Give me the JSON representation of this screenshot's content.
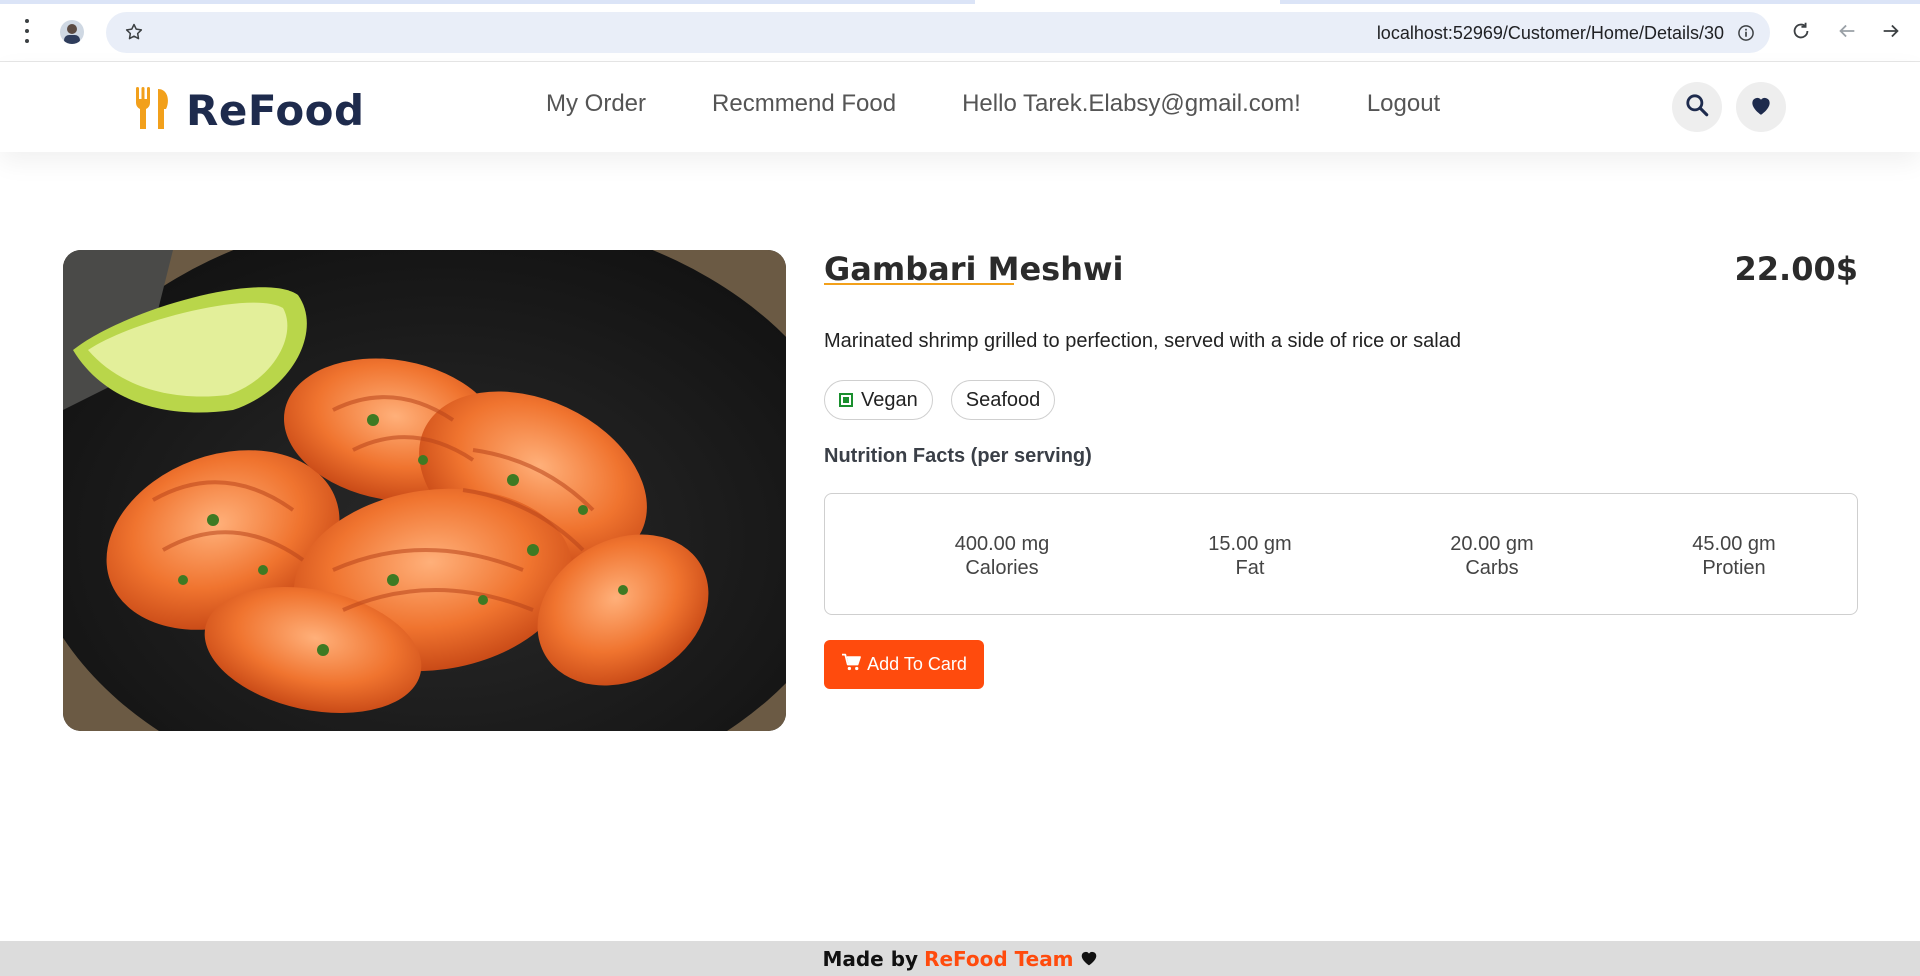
{
  "browser": {
    "url": "localhost:52969/Customer/Home/Details/30",
    "icons": [
      "menu-dots-icon",
      "profile-avatar",
      "star-icon",
      "info-icon",
      "reload-icon",
      "back-icon",
      "forward-icon"
    ]
  },
  "header": {
    "brand": "ReFood",
    "nav": {
      "my_order": "My Order",
      "recommend": "Recmmend Food",
      "greeting": "Hello Tarek.Elabsy@gmail.com!",
      "logout": "Logout"
    },
    "icons": [
      "search-icon",
      "heart-icon"
    ]
  },
  "product": {
    "name": "Gambari Meshwi",
    "price": "22.00$",
    "description": "Marinated shrimp grilled to perfection, served with a side of rice or salad",
    "tags": [
      "Vegan",
      "Seafood"
    ],
    "nutrition_title": "Nutrition Facts (per serving)",
    "nutrition": [
      {
        "value": "400.00 mg",
        "label": "Calories"
      },
      {
        "value": "15.00 gm",
        "label": "Fat"
      },
      {
        "value": "20.00 gm",
        "label": "Carbs"
      },
      {
        "value": "45.00 gm",
        "label": "Protien"
      }
    ],
    "add_button": "Add To Card"
  },
  "footer": {
    "prefix": "Made by",
    "team": "ReFood Team"
  },
  "colors": {
    "accent": "#ff4b0d",
    "brand_navy": "#1e2b4d",
    "brand_orange": "#f2a01b"
  }
}
